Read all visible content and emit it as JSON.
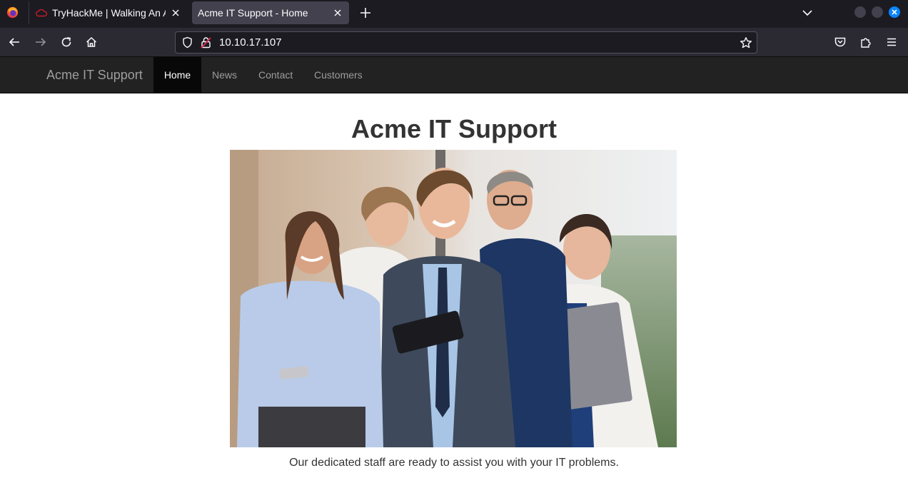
{
  "browser": {
    "tabs": [
      {
        "title": "TryHackMe | Walking An Application",
        "active": false
      },
      {
        "title": "Acme IT Support - Home",
        "active": true
      }
    ],
    "url": "10.10.17.107"
  },
  "site": {
    "brand": "Acme IT Support",
    "nav": [
      {
        "label": "Home",
        "active": true
      },
      {
        "label": "News",
        "active": false
      },
      {
        "label": "Contact",
        "active": false
      },
      {
        "label": "Customers",
        "active": false
      }
    ],
    "heading": "Acme IT Support",
    "caption": "Our dedicated staff are ready to assist you with your IT problems."
  },
  "colors": {
    "chrome_dark": "#1c1b22",
    "chrome_toolbar": "#2b2a33",
    "site_nav": "#222222",
    "nav_active": "#080808",
    "accent": "#0a84ff"
  }
}
